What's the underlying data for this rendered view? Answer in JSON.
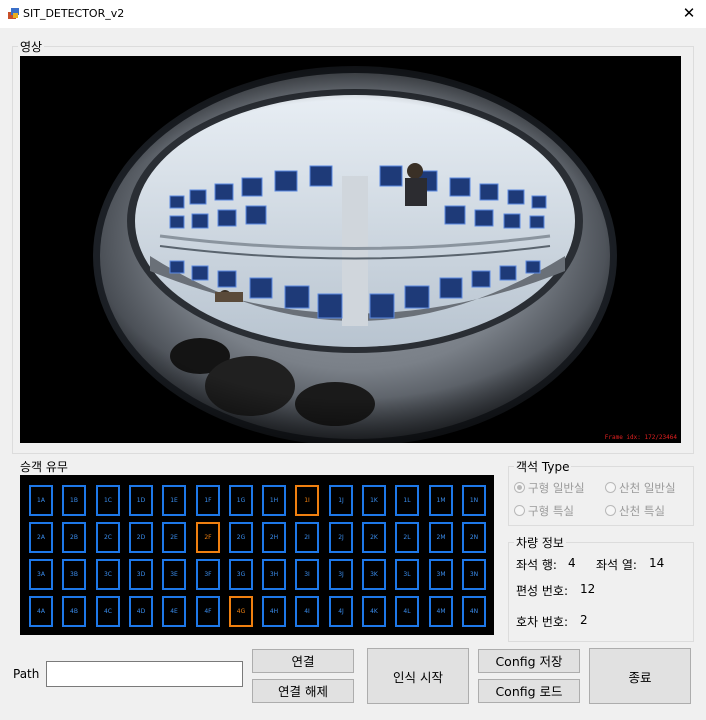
{
  "window": {
    "title": "SIT_DETECTOR_v2",
    "close_glyph": "✕"
  },
  "video": {
    "label": "영상",
    "overlay_text": "Frame idx: 172/23464",
    "camera_view": "fisheye-train-cabin"
  },
  "seats": {
    "label": "승객 유무",
    "rows": [
      [
        "1A",
        "1B",
        "1C",
        "1D",
        "1E",
        "1F",
        "1G",
        "1H",
        "1I",
        "1J",
        "1K",
        "1L",
        "1M",
        "1N"
      ],
      [
        "2A",
        "2B",
        "2C",
        "2D",
        "2E",
        "2F",
        "2G",
        "2H",
        "2I",
        "2J",
        "2K",
        "2L",
        "2M",
        "2N"
      ],
      [
        "3A",
        "3B",
        "3C",
        "3D",
        "3E",
        "3F",
        "3G",
        "3H",
        "3I",
        "3J",
        "3K",
        "3L",
        "3M",
        "3N"
      ],
      [
        "4A",
        "4B",
        "4C",
        "4D",
        "4E",
        "4F",
        "4G",
        "4H",
        "4I",
        "4J",
        "4K",
        "4L",
        "4M",
        "4N"
      ]
    ],
    "occupied": [
      "1I",
      "2F",
      "4G"
    ],
    "colors": {
      "empty": "#1e78e8",
      "occupied": "#f08010",
      "background": "#000000"
    }
  },
  "car_type": {
    "label": "객석 Type",
    "options": [
      {
        "label": "구형 일반실",
        "selected": true
      },
      {
        "label": "산천 일반실",
        "selected": false
      },
      {
        "label": "구형 특실",
        "selected": false
      },
      {
        "label": "산천 특실",
        "selected": false
      }
    ]
  },
  "vehicle_info": {
    "label": "차량 정보",
    "seat_rows_label": "좌석 행:",
    "seat_rows_value": "4",
    "seat_cols_label": "좌석 열:",
    "seat_cols_value": "14",
    "formation_label": "편성 번호:",
    "formation_value": "12",
    "car_number_label": "호차 번호:",
    "car_number_value": "2"
  },
  "controls": {
    "path_label": "Path",
    "path_value": "",
    "connect": "연결",
    "disconnect": "연결 해제",
    "start_detection": "인식 시작",
    "config_save": "Config 저장",
    "config_load": "Config 로드",
    "exit": "종료"
  }
}
